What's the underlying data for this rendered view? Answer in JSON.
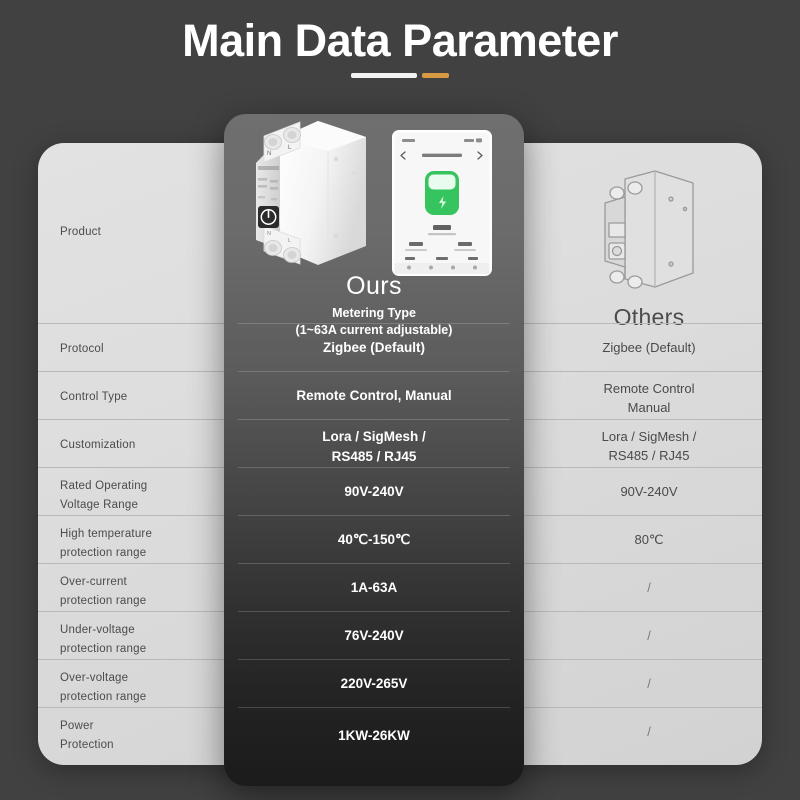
{
  "header": {
    "title": "Main Data Parameter",
    "accent_white": "#f2f2f2",
    "accent_gold": "#d79a43"
  },
  "columns": {
    "feature_label": "Product",
    "ours": {
      "title": "Ours",
      "subtitle_line1": "Metering Type",
      "subtitle_line2": "(1~63A current adjustable)",
      "product_image_name": "din-rail-smart-circuit-breaker-white",
      "app_image_name": "smartphone-app-energy-meter-screen"
    },
    "others": {
      "title": "Others",
      "product_image_name": "din-rail-circuit-breaker-outline"
    }
  },
  "rows": [
    {
      "label": "Product",
      "ours": "",
      "others": ""
    },
    {
      "label": "Protocol",
      "ours": "Zigbee (Default)",
      "others": "Zigbee (Default)"
    },
    {
      "label": "Control Type",
      "ours": "Remote Control, Manual",
      "others_line1": "Remote Control",
      "others_line2": "Manual"
    },
    {
      "label": "Customization",
      "ours_line1": "Lora / SigMesh /",
      "ours_line2": "RS485 / RJ45",
      "others_line1": "Lora / SigMesh /",
      "others_line2": "RS485 / RJ45"
    },
    {
      "label_line1": "Rated Operating",
      "label_line2": "Voltage Range",
      "ours": "90V-240V",
      "others": "90V-240V"
    },
    {
      "label_line1": "High temperature",
      "label_line2": "protection range",
      "ours": "40℃-150℃",
      "others": "80℃"
    },
    {
      "label_line1": "Over-current",
      "label_line2": "protection range",
      "ours": "1A-63A",
      "others": "/"
    },
    {
      "label_line1": "Under-voltage",
      "label_line2": "protection range",
      "ours": "76V-240V",
      "others": "/"
    },
    {
      "label_line1": "Over-voltage",
      "label_line2": "protection range",
      "ours": "220V-265V",
      "others": "/"
    },
    {
      "label_line1": "Power",
      "label_line2": "Protection",
      "ours": "1KW-26KW",
      "others": "/"
    }
  ],
  "colors": {
    "background": "#414141",
    "panel": "#dcdcdc",
    "center_card_top": "#6f6f6f",
    "center_card_bottom": "#1b1b1b",
    "label_text": "#4b4b4b",
    "ours_text": "#ffffff"
  }
}
